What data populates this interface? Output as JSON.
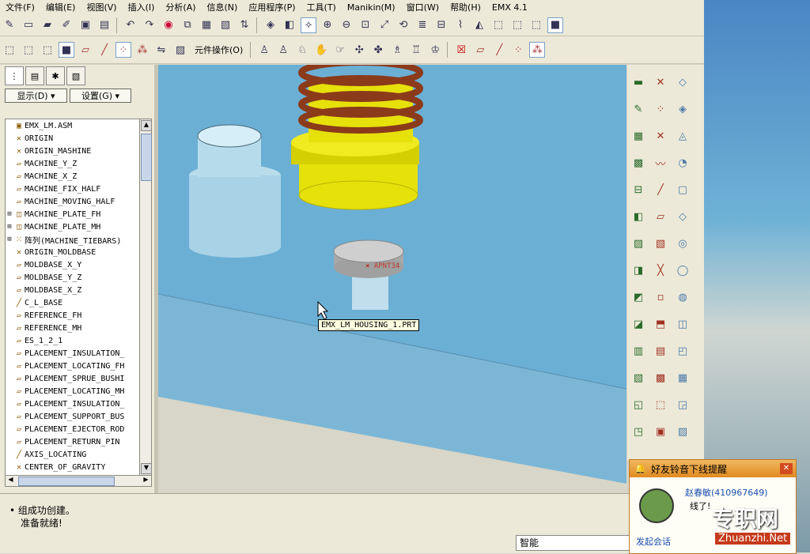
{
  "menu": [
    "文件(F)",
    "编辑(E)",
    "视图(V)",
    "插入(I)",
    "分析(A)",
    "信息(N)",
    "应用程序(P)",
    "工具(T)",
    "Manikin(M)",
    "窗口(W)",
    "帮助(H)",
    "EMX 4.1"
  ],
  "toolbar2": {
    "component_ops_label": "元件操作(O)"
  },
  "left_panel": {
    "show_label": "显示(D) ▾",
    "settings_label": "设置(G) ▾",
    "tree_items": [
      {
        "label": "EMX_LM.ASM",
        "icon": "assembly-icon",
        "expand": false
      },
      {
        "label": "ORIGIN",
        "icon": "csys-icon",
        "expand": false
      },
      {
        "label": "ORIGIN_MASHINE",
        "icon": "csys-icon",
        "expand": false
      },
      {
        "label": "MACHINE_Y_Z",
        "icon": "datum-plane-icon",
        "expand": false
      },
      {
        "label": "MACHINE_X_Z",
        "icon": "datum-plane-icon",
        "expand": false
      },
      {
        "label": "MACHINE_FIX_HALF",
        "icon": "datum-plane-icon",
        "expand": false
      },
      {
        "label": "MACHINE_MOVING_HALF",
        "icon": "datum-plane-icon",
        "expand": false
      },
      {
        "label": "MACHINE_PLATE_FH",
        "icon": "part-icon",
        "expand": true
      },
      {
        "label": "MACHINE_PLATE_MH",
        "icon": "part-icon",
        "expand": true
      },
      {
        "label": "阵列(MACHINE_TIEBARS)",
        "icon": "pattern-icon",
        "expand": true
      },
      {
        "label": "ORIGIN_MOLDBASE",
        "icon": "csys-icon",
        "expand": false
      },
      {
        "label": "MOLDBASE_X_Y",
        "icon": "datum-plane-icon",
        "expand": false
      },
      {
        "label": "MOLDBASE_Y_Z",
        "icon": "datum-plane-icon",
        "expand": false
      },
      {
        "label": "MOLDBASE_X_Z",
        "icon": "datum-plane-icon",
        "expand": false
      },
      {
        "label": "C_L_BASE",
        "icon": "axis-icon",
        "expand": false
      },
      {
        "label": "REFERENCE_FH",
        "icon": "datum-plane-icon",
        "expand": false
      },
      {
        "label": "REFERENCE_MH",
        "icon": "datum-plane-icon",
        "expand": false
      },
      {
        "label": "ES_1_2_1",
        "icon": "datum-plane-icon",
        "expand": false
      },
      {
        "label": "PLACEMENT_INSULATION_",
        "icon": "datum-plane-icon",
        "expand": false
      },
      {
        "label": "PLACEMENT_LOCATING_FH",
        "icon": "datum-plane-icon",
        "expand": false
      },
      {
        "label": "PLACEMENT_SPRUE_BUSHI",
        "icon": "datum-plane-icon",
        "expand": false
      },
      {
        "label": "PLACEMENT_LOCATING_MH",
        "icon": "datum-plane-icon",
        "expand": false
      },
      {
        "label": "PLACEMENT_INSULATION_",
        "icon": "datum-plane-icon",
        "expand": false
      },
      {
        "label": "PLACEMENT_SUPPORT_BUS",
        "icon": "datum-plane-icon",
        "expand": false
      },
      {
        "label": "PLACEMENT_EJECTOR_ROD",
        "icon": "datum-plane-icon",
        "expand": false
      },
      {
        "label": "PLACEMENT_RETURN_PIN",
        "icon": "datum-plane-icon",
        "expand": false
      },
      {
        "label": "AXIS_LOCATING",
        "icon": "axis-icon",
        "expand": false
      },
      {
        "label": "CENTER_OF_GRAVITY",
        "icon": "csys-icon",
        "expand": false
      }
    ]
  },
  "viewport": {
    "point_label": "APNT34",
    "tooltip": "EMX_LM_HOUSING_1.PRT",
    "colors": {
      "bg": "#6bafd4",
      "spring": "#8b3a1a",
      "yellow": "#e6e10a",
      "cyl": "#a8d4e8",
      "part": "#c8c8c8"
    }
  },
  "status": {
    "line1": "• 组成功创建。",
    "line2": "准备就绪!",
    "filter_value": "智能"
  },
  "notification": {
    "title": "好友铃音下线提醒",
    "contact": "赵春敏(410967649)",
    "message": "线了!",
    "link": "发起会话"
  },
  "watermark": {
    "brand": "专职网",
    "site": "Zhuanzhi.Net"
  }
}
